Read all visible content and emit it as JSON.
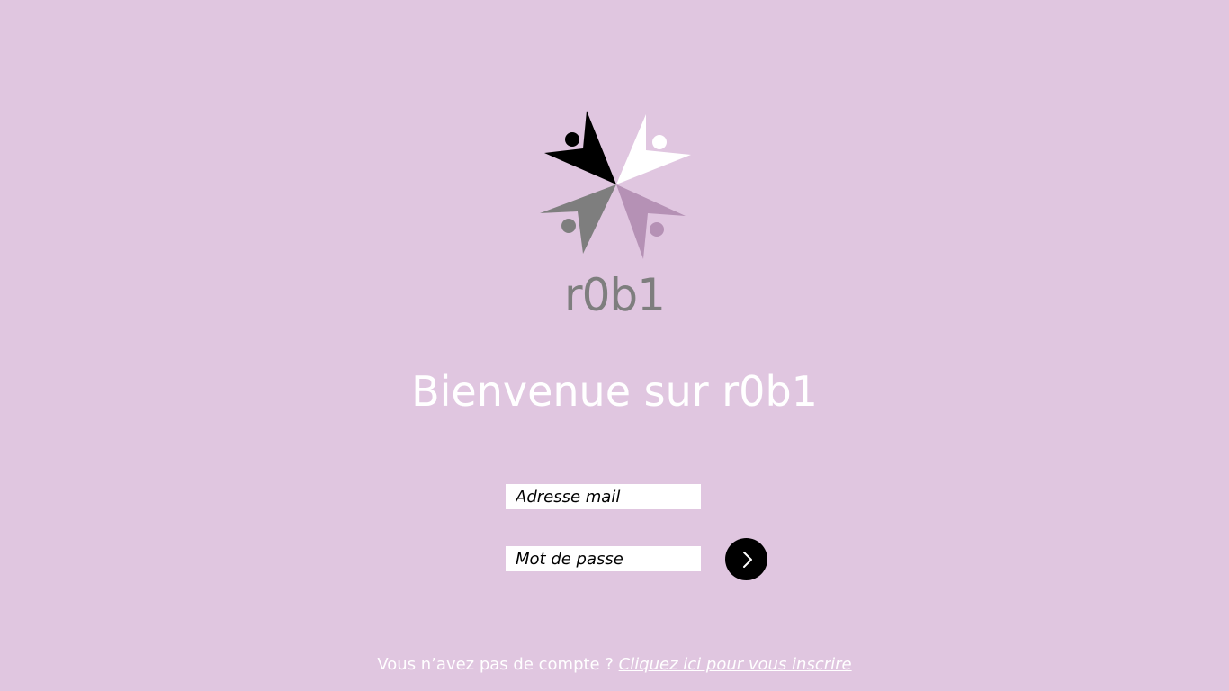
{
  "theme": {
    "background": "#e0c6e0",
    "button_color": "#000000",
    "text_color": "#ffffff",
    "logo_colors": {
      "top_left": "#000000",
      "top_right": "#ffffff",
      "bottom_left": "#7e7e7e",
      "bottom_right": "#b591b5",
      "wordmark": "#7e7e7e"
    }
  },
  "logo": {
    "wordmark": "r0b1"
  },
  "welcome": {
    "title": "Bienvenue sur r0b1"
  },
  "form": {
    "email": {
      "placeholder": "Adresse mail",
      "value": ""
    },
    "password": {
      "placeholder": "Mot de passe",
      "value": ""
    },
    "submit_icon": "chevron-right-icon"
  },
  "signup": {
    "prompt": "Vous n’avez pas de compte ?",
    "link_label": "Cliquez ici pour vous inscrire"
  }
}
